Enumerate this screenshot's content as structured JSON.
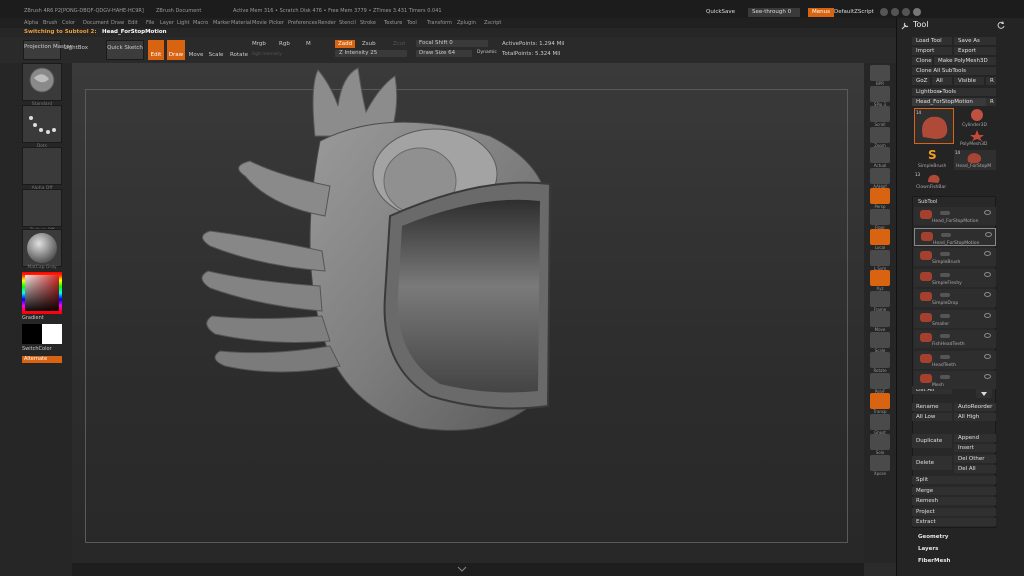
{
  "titlebar": {
    "app": "ZBrush 4R6 P2[PONG-DBQF-QDGV-HAHE-HC9R]",
    "document": "ZBrush Document",
    "stats": "Active Mem 316 • Scratch Disk 476 • Free Mem 3779 • ZTimes 3.431 Timers 0.041",
    "quicksave": "QuickSave",
    "seethrough": "See-through 0",
    "menus_btn": "Menus",
    "script": "DefaultZScript"
  },
  "menubar": [
    "Alpha",
    "Brush",
    "Color",
    "Document",
    "Draw",
    "Edit",
    "File",
    "Layer",
    "Light",
    "Macro",
    "Marker",
    "Material",
    "Movie",
    "Picker",
    "Preferences",
    "Render",
    "Stencil",
    "Stroke",
    "Texture",
    "Tool",
    "Transform",
    "Zplugin",
    "Zscript"
  ],
  "inforow": {
    "label": "Switching to Subtool 2:",
    "value": "Head_ForStopMotion"
  },
  "shelf": {
    "projection_master": "Projection Master",
    "lightbox": "LightBox",
    "quick_sketch": "Quick Sketch",
    "edit": "Edit",
    "draw": "Draw",
    "move": "Move",
    "scale": "Scale",
    "rotate": "Rotate",
    "mrgb": "Mrgb",
    "rgb": "Rgb",
    "m": "M",
    "rgb_intensity": "Rgb Intensity",
    "zadd": "Zadd",
    "zsub": "Zsub",
    "zcut": "Zcut",
    "z_intensity": "Z Intensity 25",
    "focal_shift": "Focal Shift 0",
    "draw_size": "Draw Size 64",
    "dynamic": "Dynamic",
    "active_points": "ActivePoints: 1.294 Mil",
    "total_points": "TotalPoints: 5.324 Mil"
  },
  "lefttray": {
    "labels": [
      "Standard",
      "Dots",
      "Alpha Off",
      "Texture Off",
      "MatCap Gray"
    ],
    "gradient": "Gradient",
    "switch_color": "SwitchColor",
    "alternate": "Alternate"
  },
  "rightshelf": [
    "BPR",
    "SPix 3",
    "Scroll",
    "Zoom",
    "Actual",
    "AAHalf",
    "Persp",
    "Floor",
    "Local",
    "L.Sym",
    "Xyz",
    "Frame",
    "Move",
    "Scale",
    "Rotate",
    "PolyF",
    "Transp",
    "Ghost",
    "Solo",
    "Xpose"
  ],
  "palette": {
    "title": "Tool",
    "load_tool": "Load Tool",
    "save_as": "Save As",
    "import": "Import",
    "export": "Export",
    "clone": "Clone",
    "make_polymesh": "Make PolyMesh3D",
    "clone_all": "Clone All SubTools",
    "goz": "GoZ",
    "all": "All",
    "visible": "Visible",
    "r": "R",
    "lightbox_tools": "Lightbox▸Tools",
    "current_tool": "Head_ForStopMotion",
    "current_tool_count": "R",
    "tools": [
      {
        "label": "",
        "count": "14"
      },
      {
        "label": "Cylinder3D"
      },
      {
        "label": "PolyMesh3D"
      },
      {
        "label": "SimpleBrush"
      },
      {
        "label": "Head_ForStopM",
        "count": "14"
      },
      {
        "label": "ClownFishBar",
        "count": "13"
      }
    ],
    "subtool_title": "SubTool",
    "subtools": [
      "Head_ForStopMotion",
      "Head_ForStopMotion",
      "SimpleBrush",
      "SimpleFleshy",
      "SimpleDrop",
      "Smaller",
      "FishHeadTeeth",
      "HeadTeeth",
      "Mesh"
    ],
    "list_all": "List All",
    "rename": "Rename",
    "auto_reorder": "AutoReorder",
    "all_low": "All Low",
    "all_high": "All High",
    "duplicate": "Duplicate",
    "append": "Append",
    "insert": "Insert",
    "delete": "Delete",
    "del_other": "Del Other",
    "del_all": "Del All",
    "split": "Split",
    "merge": "Merge",
    "remesh": "Remesh",
    "project": "Project",
    "extract": "Extract",
    "geometry": "Geometry",
    "layers": "Layers",
    "fibermesh": "FiberMesh"
  },
  "colors": {
    "accent": "#d86412",
    "panel": "#242424",
    "canvas": "#333333"
  }
}
